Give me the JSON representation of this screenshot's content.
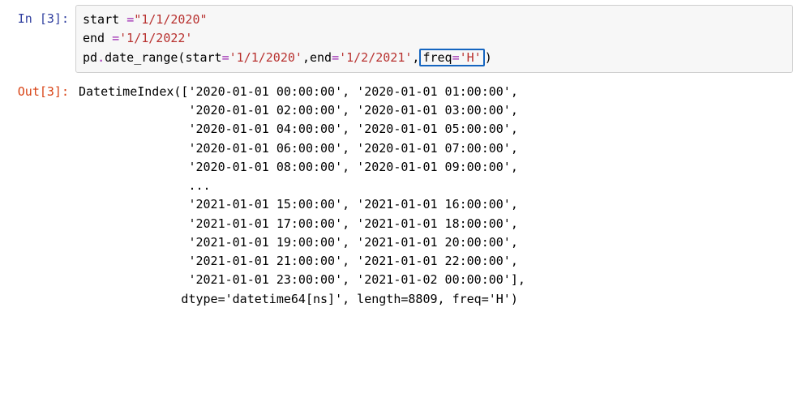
{
  "prompts": {
    "in": "In [3]:",
    "out": "Out[3]:"
  },
  "code": {
    "line1_start": "start ",
    "line1_eq": "=",
    "line1_str": "\"1/1/2020\"",
    "line2_end": "end ",
    "line2_eq": "=",
    "line2_str": "'1/1/2022'",
    "line3_prefix": "pd",
    "line3_dot": ".",
    "line3_call": "date_range",
    "line3_p_open": "(",
    "line3_kw1": "start",
    "line3_eq1": "=",
    "line3_str1": "'1/1/2020'",
    "line3_comma1": ",",
    "line3_kw2": "end",
    "line3_eq2": "=",
    "line3_str2": "'1/2/2021'",
    "line3_comma2": ",",
    "line3_kw3": "freq",
    "line3_eq3": "=",
    "line3_str3": "'H'",
    "line3_p_close": ")"
  },
  "out": {
    "l01": "DatetimeIndex(['2020-01-01 00:00:00', '2020-01-01 01:00:00',",
    "l02": "               '2020-01-01 02:00:00', '2020-01-01 03:00:00',",
    "l03": "               '2020-01-01 04:00:00', '2020-01-01 05:00:00',",
    "l04": "               '2020-01-01 06:00:00', '2020-01-01 07:00:00',",
    "l05": "               '2020-01-01 08:00:00', '2020-01-01 09:00:00',",
    "l06": "               ...",
    "l07": "               '2021-01-01 15:00:00', '2021-01-01 16:00:00',",
    "l08": "               '2021-01-01 17:00:00', '2021-01-01 18:00:00',",
    "l09": "               '2021-01-01 19:00:00', '2021-01-01 20:00:00',",
    "l10": "               '2021-01-01 21:00:00', '2021-01-01 22:00:00',",
    "l11": "               '2021-01-01 23:00:00', '2021-01-02 00:00:00'],",
    "l12": "              dtype='datetime64[ns]', length=8809, freq='H')"
  }
}
